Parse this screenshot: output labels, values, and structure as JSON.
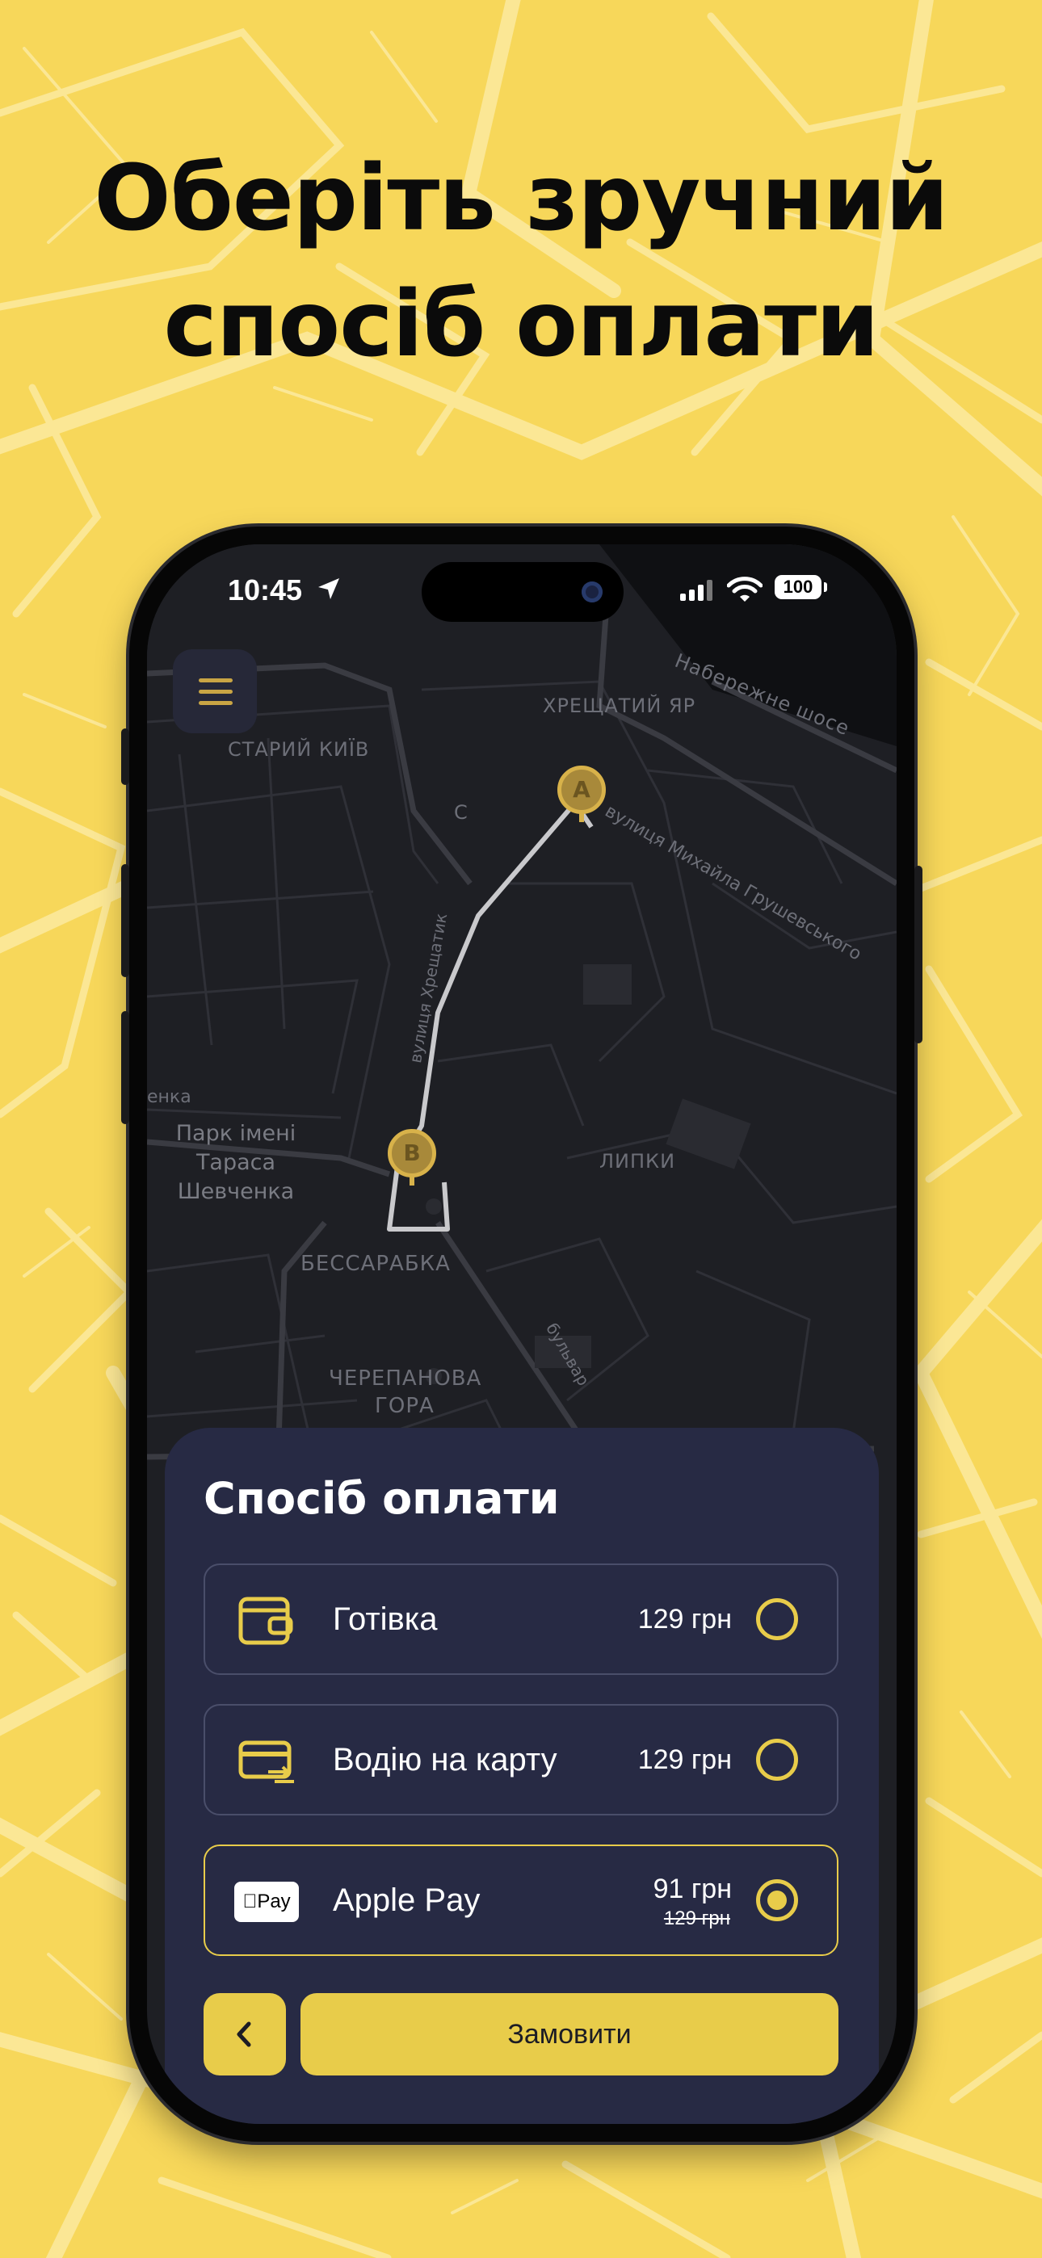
{
  "headline": {
    "line1": "Оберіть зручний",
    "line2": "спосіб оплати"
  },
  "status_bar": {
    "time": "10:45",
    "battery": "100"
  },
  "map": {
    "labels": {
      "naberezhne": "Набережне шосе",
      "khreshchatyi_yar": "ХРЕЩАТИЙ ЯР",
      "staryi_kyiv": "СТАРИЙ КИЇВ",
      "hrushevskoho": "вулиця Михайла Грушевського",
      "khreshchatyk": "вулиця Хрещатик",
      "lypky": "ЛИПКИ",
      "bessarabka": "БЕССАРАБКА",
      "cherepanova": "ЧЕРЕПАНОВА",
      "hora": "ГОРА",
      "bulvar": "бульвар",
      "enka": "енка",
      "park_line1": "Парк імені",
      "park_line2": "Тараса",
      "park_line3": "Шевченка",
      "c": "С"
    },
    "pin_a": "A",
    "pin_b": "B"
  },
  "payment": {
    "title": "Спосіб оплати",
    "options": [
      {
        "label": "Готівка",
        "price": "129 грн",
        "icon": "wallet-icon",
        "selected": false
      },
      {
        "label": "Водію на карту",
        "price": "129 грн",
        "icon": "card-transfer-icon",
        "selected": false
      },
      {
        "label": "Apple Pay",
        "price": "91 грн",
        "old_price": "129 грн",
        "icon": "apple-pay-icon",
        "badge": "Pay",
        "selected": true
      }
    ],
    "order_button": "Замовити"
  },
  "colors": {
    "background": "#f7d75a",
    "accent": "#e8cc4a",
    "sheet": "#272a44",
    "map": "#1e1f24"
  }
}
